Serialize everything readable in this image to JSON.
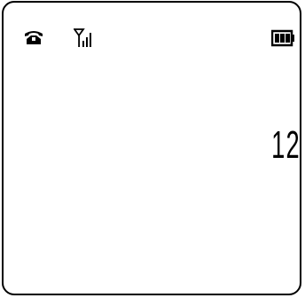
{
  "status_bar": {
    "icons": [
      "phone-handset-icon",
      "signal-strength-icon",
      "battery-icon"
    ]
  },
  "display": {
    "value": "12"
  }
}
